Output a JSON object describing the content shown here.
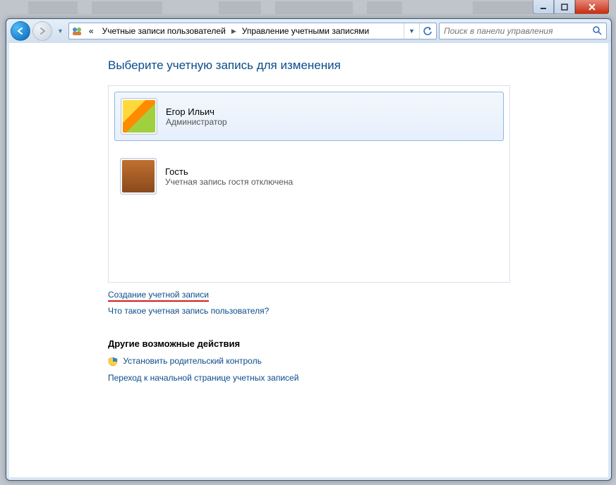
{
  "breadcrumb": {
    "prefix": "«",
    "seg1": "Учетные записи пользователей",
    "seg2": "Управление учетными записями"
  },
  "search": {
    "placeholder": "Поиск в панели управления"
  },
  "page": {
    "title": "Выберите учетную запись для изменения"
  },
  "accounts": [
    {
      "name": "Егор Ильич",
      "role": "Администратор"
    },
    {
      "name": "Гость",
      "role": "Учетная запись гостя отключена"
    }
  ],
  "links": {
    "create": "Создание учетной записи",
    "what": "Что такое учетная запись пользователя?"
  },
  "other": {
    "heading": "Другие возможные действия",
    "parental": "Установить родительский контроль",
    "gohome": "Переход к начальной странице учетных записей"
  }
}
